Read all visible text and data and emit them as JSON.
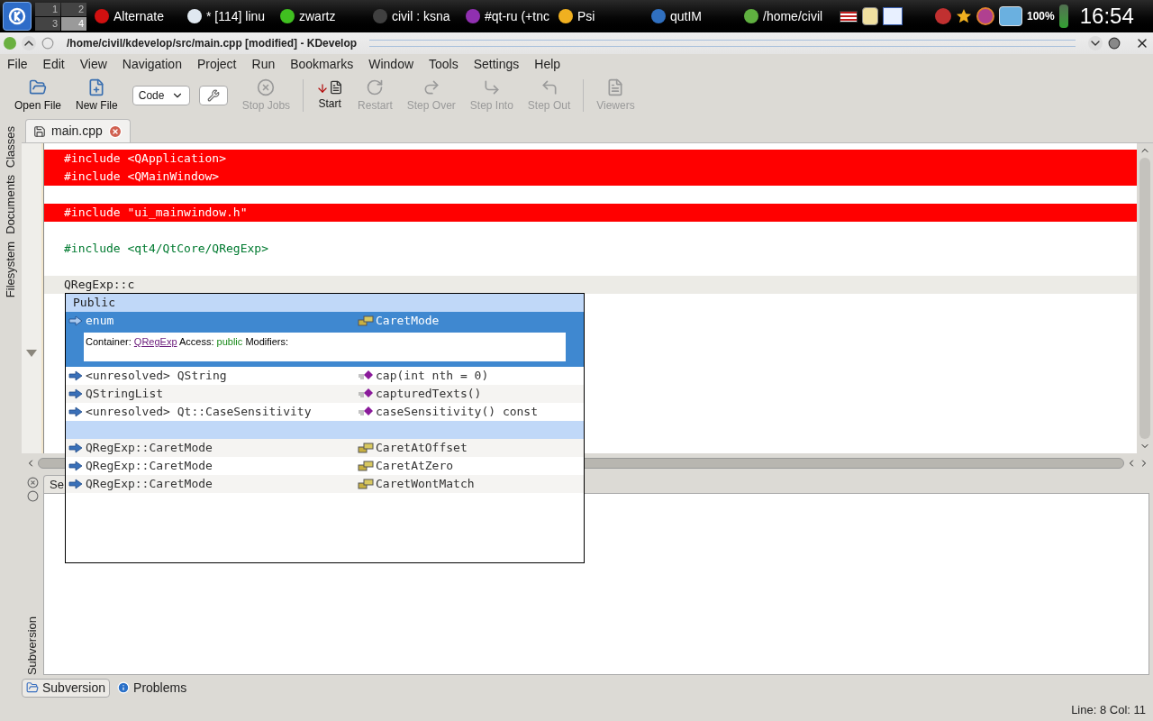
{
  "taskbar": {
    "pager": [
      {
        "label": "1",
        "selected": false
      },
      {
        "label": "2",
        "selected": false
      },
      {
        "label": "3",
        "selected": false
      },
      {
        "label": "4",
        "selected": true
      }
    ],
    "tasks": [
      {
        "label": "Alternate",
        "color": "#d01010"
      },
      {
        "label": "* [114] linu",
        "color": "#e0e8f0"
      },
      {
        "label": "zwartz",
        "color": "#40c020"
      },
      {
        "label": "civil : ksna",
        "color": "#404040"
      },
      {
        "label": "#qt-ru (+tnc",
        "color": "#9030b0"
      },
      {
        "label": "Psi",
        "color": "#f0b020"
      },
      {
        "label": "qutIM",
        "color": "#3070c0"
      },
      {
        "label": "/home/civil",
        "color": "#60b040"
      }
    ],
    "battery": "100%",
    "clock": "16:54"
  },
  "window": {
    "title": "/home/civil/kdevelop/src/main.cpp [modified] - KDevelop"
  },
  "menu": [
    "File",
    "Edit",
    "View",
    "Navigation",
    "Project",
    "Run",
    "Bookmarks",
    "Window",
    "Tools",
    "Settings",
    "Help"
  ],
  "toolbar": [
    {
      "kind": "button",
      "label": "Open File",
      "disabled": false
    },
    {
      "kind": "button",
      "label": "New File",
      "disabled": false
    },
    {
      "kind": "combo",
      "label": "Code"
    },
    {
      "kind": "wrench"
    },
    {
      "kind": "button",
      "label": "Stop Jobs",
      "disabled": true
    },
    {
      "kind": "separator"
    },
    {
      "kind": "button",
      "label": "Start",
      "disabled": false
    },
    {
      "kind": "button",
      "label": "Restart",
      "disabled": true
    },
    {
      "kind": "button",
      "label": "Step Over",
      "disabled": true
    },
    {
      "kind": "button",
      "label": "Step Into",
      "disabled": true
    },
    {
      "kind": "button",
      "label": "Step Out",
      "disabled": true
    },
    {
      "kind": "separator"
    },
    {
      "kind": "button",
      "label": "Viewers",
      "disabled": true
    }
  ],
  "left_dock": [
    {
      "label": "Classes"
    },
    {
      "label": "Documents"
    },
    {
      "label": "Filesystem"
    }
  ],
  "editor_tabs": [
    {
      "label": "main.cpp",
      "selected": true
    }
  ],
  "code": [
    {
      "text": "#include <QApplication>",
      "kind": "include",
      "highlighted": true
    },
    {
      "text": "#include <QMainWindow>",
      "kind": "include",
      "highlighted": true
    },
    {
      "kind": "blank",
      "highlighted": false
    },
    {
      "text": "#include \"ui_mainwindow.h\"",
      "kind": "include",
      "highlighted": true
    },
    {
      "kind": "blank",
      "highlighted": false
    },
    {
      "text": "#include <qt4/QtCore/QRegExp>",
      "kind": "include",
      "highlighted": false
    },
    {
      "kind": "blank",
      "highlighted": false
    },
    {
      "text": "QRegExp::c",
      "kind": "plain",
      "highlighted": false,
      "current": true
    }
  ],
  "completion": {
    "groups": [
      {
        "title": "Public",
        "items": [
          {
            "type": "enum",
            "name": "CaretMode",
            "kind": "enum",
            "selected": true
          },
          {
            "type": "<unresolved> QString",
            "name": "cap(int nth = 0)",
            "kind": "function",
            "selected": false
          },
          {
            "type": "QStringList",
            "name": "capturedTexts()",
            "kind": "function",
            "selected": false
          },
          {
            "type": "<unresolved> Qt::CaseSensitivity",
            "name": "caseSensitivity() const",
            "kind": "function",
            "selected": false
          }
        ]
      },
      {
        "items": [
          {
            "type": "QRegExp::CaretMode",
            "name": "CaretAtOffset",
            "kind": "enum",
            "selected": false
          },
          {
            "type": "QRegExp::CaretMode",
            "name": "CaretAtZero",
            "kind": "enum",
            "selected": false
          },
          {
            "type": "QRegExp::CaretMode",
            "name": "CaretWontMatch",
            "kind": "enum",
            "selected": false
          }
        ]
      }
    ],
    "detail": {
      "container_label": "Container:",
      "container": "QRegExp",
      "access_label": "Access:",
      "access": "public",
      "modifiers_label": "Modifiers:"
    }
  },
  "bottom_panel": {
    "tab": "Se",
    "label": "Subversion"
  },
  "bottom_tabs": [
    {
      "label": "Subversion",
      "selected": true
    },
    {
      "label": "Problems",
      "selected": false
    }
  ],
  "status_bar": "Line: 8 Col: 11"
}
